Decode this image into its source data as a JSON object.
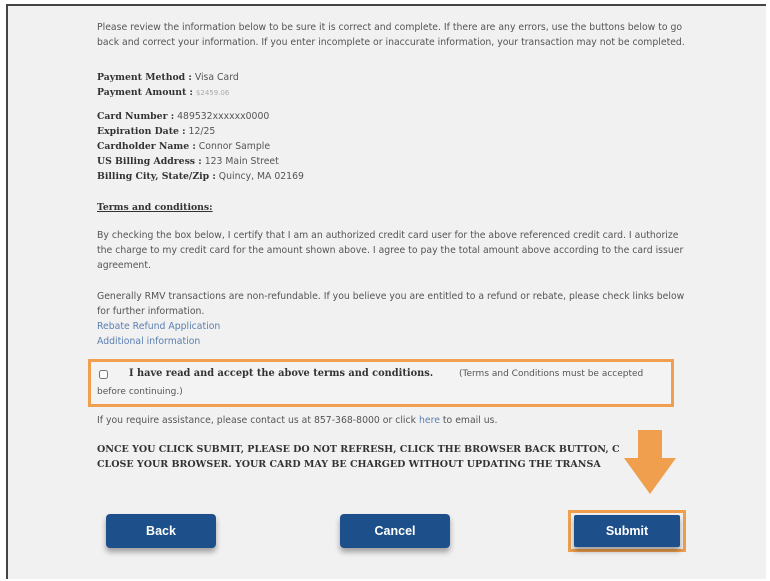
{
  "intro": "Please review the information below to be sure it is correct and complete. If there are any errors, use the buttons below to go back and correct your information. If you enter incomplete or inaccurate information, your transaction may not be completed.",
  "payment": {
    "method_label": "Payment Method :",
    "method_value": "Visa Card",
    "amount_label": "Payment Amount :",
    "amount_value": "$2459.06"
  },
  "card": {
    "number_label": "Card Number :",
    "number_value": "489532xxxxxx0000",
    "exp_label": "Expiration Date :",
    "exp_value": "12/25",
    "holder_label": "Cardholder Name :",
    "holder_value": "Connor Sample",
    "address_label": "US Billing Address :",
    "address_value": "123 Main Street",
    "city_label": "Billing City, State/Zip :",
    "city_value": "Quincy, MA 02169"
  },
  "terms_heading": "Terms and conditions:",
  "terms_text": "By checking the box below, I certify that I am an authorized credit card user for the above referenced credit card. I authorize the charge to my credit card for the amount shown above. I agree to pay the total amount above according to the card issuer agreement.",
  "refund_text": "Generally RMV transactions are non-refundable. If you believe you are entitled to a refund or rebate, please check links below for further information.",
  "links": {
    "rebate": "Rebate Refund Application",
    "additional": "Additional information"
  },
  "accept": {
    "strong": "I have read and accept the above terms and conditions.",
    "note_1": "(Terms and Conditions must be accepted",
    "note_2": "before continuing.)"
  },
  "assist": {
    "pre": "If you require assistance, please contact us at 857-368-8000 or click",
    "link": "here",
    "post": "to email us."
  },
  "warning": {
    "line1": "ONCE YOU CLICK SUBMIT, PLEASE DO NOT REFRESH, CLICK THE BROWSER BACK BUTTON, C",
    "line2": "CLOSE YOUR BROWSER. YOUR CARD MAY BE CHARGED WITHOUT UPDATING THE TRANSA"
  },
  "buttons": {
    "back": "Back",
    "cancel": "Cancel",
    "submit": "Submit"
  },
  "colors": {
    "button_blue": "#1d4f8a",
    "highlight_orange": "#ef9f4e",
    "link_blue": "#5b7fb0"
  }
}
